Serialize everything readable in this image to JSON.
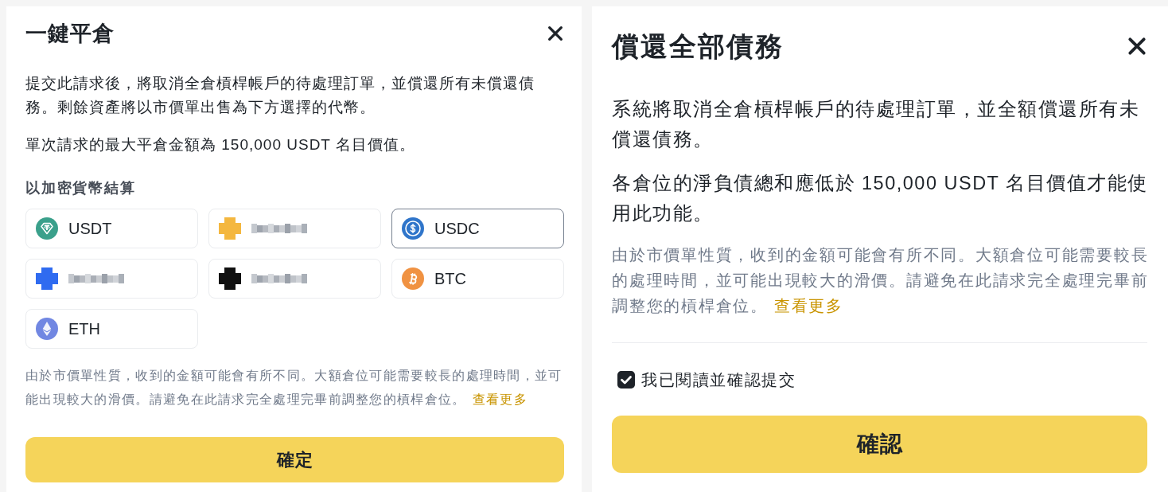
{
  "close_position_dialog": {
    "title": "一鍵平倉",
    "paragraphs": [
      "提交此請求後，將取消全倉槓桿帳戶的待處理訂單，並償還所有未償還債務。剩餘資產將以市價單出售為下方選擇的代幣。",
      "單次請求的最大平倉金額為 150,000 USDT 名目價值。"
    ],
    "settlement": {
      "label": "以加密貨幣結算",
      "options": [
        {
          "kind": "tether",
          "label": "USDT",
          "selected": false
        },
        {
          "kind": "redacted",
          "color": "#f4b73f",
          "selected": false
        },
        {
          "kind": "dollar",
          "label": "USDC",
          "selected": true
        },
        {
          "kind": "redacted",
          "color": "#2f6bf0",
          "selected": false
        },
        {
          "kind": "redacted",
          "color": "#111111",
          "selected": false
        },
        {
          "kind": "bitcoin",
          "label": "BTC",
          "selected": false
        },
        {
          "kind": "ethereum",
          "label": "ETH",
          "selected": false
        }
      ]
    },
    "note": {
      "text": "由於市價單性質，收到的金額可能會有所不同。大額倉位可能需要較長的處理時間，並可能出現較大的滑價。請避免在此請求完全處理完畢前調整您的槓桿倉位。",
      "link": "查看更多"
    },
    "confirm_button": "確定"
  },
  "repay_dialog": {
    "title": "償還全部債務",
    "paragraphs": [
      "系統將取消全倉槓桿帳戶的待處理訂單，並全額償還所有未償還債務。",
      "各倉位的淨負債總和應低於 150,000 USDT 名目價值才能使用此功能。"
    ],
    "note": {
      "text": "由於市價單性質，收到的金額可能會有所不同。大額倉位可能需要較長的處理時間，並可能出現較大的滑價。請避免在此請求完全處理完畢前調整您的槓桿倉位。",
      "link": "查看更多"
    },
    "agreement": {
      "label": "我已閱讀並確認提交",
      "checked": true
    },
    "confirm_button": "確認"
  }
}
